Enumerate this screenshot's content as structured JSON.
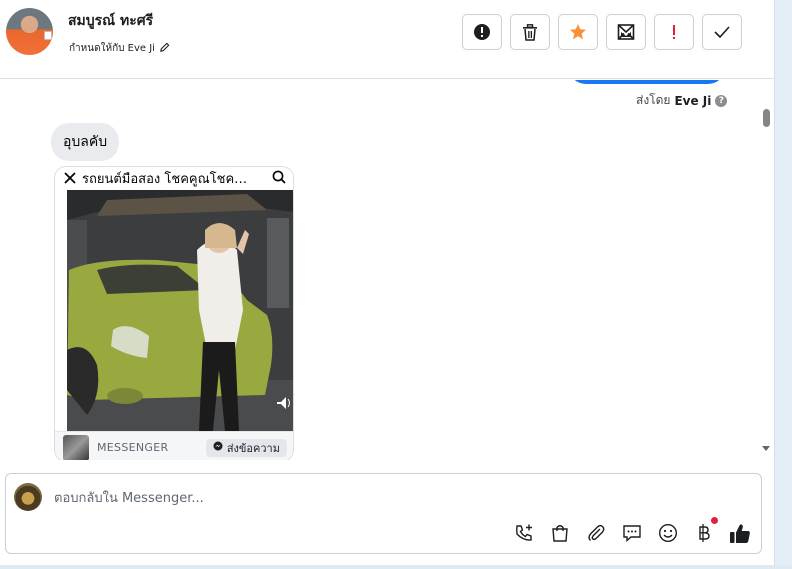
{
  "header": {
    "contact_name": "สมบูรณ์ ทะศรี",
    "assigned_label": "กำหนดให้กับ Eve Ji"
  },
  "conversation": {
    "sent_by_prefix": "ส่งโดย",
    "sent_by_name": "Eve Ji",
    "incoming_message": "อุบลคับ",
    "card": {
      "title": "รถยนต์มือสอง โชคคูณโชค…",
      "source_label": "MESSENGER",
      "send_button_label": "ส่งข้อความ"
    }
  },
  "composer": {
    "placeholder": "ตอบกลับใน Messenger..."
  },
  "colors": {
    "accent": "#1877f2",
    "star": "#f7923a",
    "alert_red": "#e41e3f"
  },
  "icons": [
    "alert-circle-icon",
    "trash-icon",
    "star-icon",
    "mark-unread-icon",
    "exclamation-icon",
    "check-icon",
    "pencil-icon",
    "close-icon",
    "search-icon",
    "volume-icon",
    "messenger-icon",
    "call-add-icon",
    "shopping-bag-icon",
    "paperclip-icon",
    "saved-reply-icon",
    "emoji-icon",
    "baht-icon",
    "thumbs-up-icon"
  ]
}
